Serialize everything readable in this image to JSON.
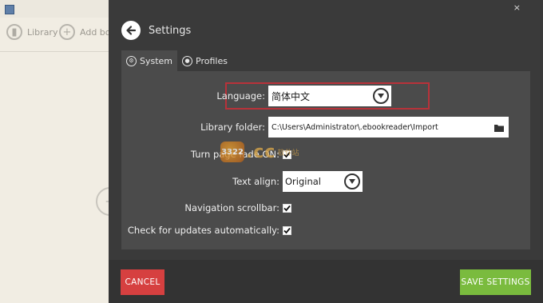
{
  "background_app": {
    "library_label": "Library",
    "add_books_label": "Add bo"
  },
  "modal": {
    "title": "Settings",
    "close_glyph": "×",
    "tabs": [
      {
        "label": "System",
        "active": true,
        "icon": "gears-icon"
      },
      {
        "label": "Profiles",
        "active": false,
        "icon": "user-icon"
      }
    ],
    "settings": {
      "language": {
        "label": "Language:",
        "value": "简体中文"
      },
      "library_folder": {
        "label": "Library folder:",
        "value": "C:\\Users\\Administrator\\.ebookreader\\Import"
      },
      "turn_page_fade": {
        "label": "Turn page fade ON:",
        "checked": true
      },
      "text_align": {
        "label": "Text align:",
        "value": "Original"
      },
      "navigation_scrollbar": {
        "label": "Navigation scrollbar:",
        "checked": true
      },
      "check_updates": {
        "label": "Check for updates automatically:",
        "checked": true
      }
    },
    "watermark": {
      "mark": "3322",
      "text": ".cc",
      "sub": "软件站"
    },
    "buttons": {
      "cancel": "CANCEL",
      "save": "SAVE SETTINGS"
    }
  },
  "colors": {
    "modal_bg": "#3a3a3a",
    "panel_bg": "#4b4b4b",
    "cancel": "#d64040",
    "save": "#7abb3e",
    "highlight_outline": "#b8323a"
  }
}
